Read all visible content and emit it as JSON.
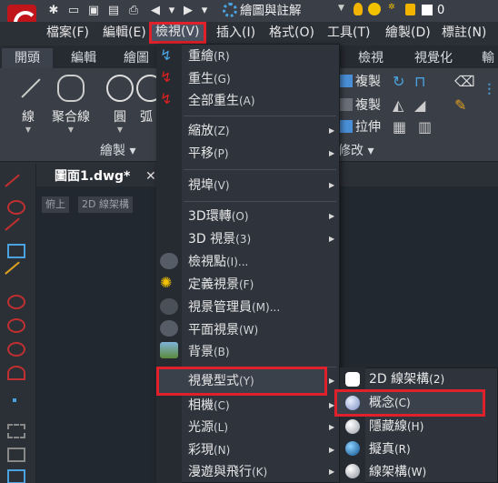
{
  "quick_access": {
    "workspace": "繪圖與註解",
    "zero_value": "0"
  },
  "menubar": {
    "items": [
      {
        "label": "檔案(F)"
      },
      {
        "label": "編輯(E)"
      },
      {
        "label": "檢視(V)"
      },
      {
        "label": "插入(I)"
      },
      {
        "label": "格式(O)"
      },
      {
        "label": "工具(T)"
      },
      {
        "label": "繪製(D)"
      },
      {
        "label": "標註(N)"
      }
    ]
  },
  "ribbon": {
    "tabs": [
      "開頭",
      "編輯",
      "繪圖",
      "檢視",
      "視覺化",
      "輸"
    ],
    "draw_buttons": [
      "線",
      "聚合線",
      "圓",
      "弧"
    ],
    "draw_panel_label": "繪製 ▾",
    "modify_rows": [
      "複製",
      "複製",
      "拉伸"
    ],
    "modify_panel_label": "修改 ▾"
  },
  "document": {
    "tab_title": "圖面1.dwg*",
    "close": "✕",
    "view_controls": [
      "俯上",
      "2D 線架構"
    ]
  },
  "view_menu": {
    "items": [
      {
        "label": "重繪",
        "key": "(R)"
      },
      {
        "label": "重生",
        "key": "(G)"
      },
      {
        "label": "全部重生",
        "key": "(A)"
      },
      {
        "label": "縮放",
        "key": "(Z)"
      },
      {
        "label": "平移",
        "key": "(P)"
      },
      {
        "label": "視埠",
        "key": "(V)"
      },
      {
        "label": "3D環轉",
        "key": "(O)"
      },
      {
        "label": "3D 視景",
        "key": "(3)"
      },
      {
        "label": "檢視點",
        "key": "(I)..."
      },
      {
        "label": "定義視景",
        "key": "(F)"
      },
      {
        "label": "視景管理員",
        "key": "(M)..."
      },
      {
        "label": "平面視景",
        "key": "(W)"
      },
      {
        "label": "背景",
        "key": "(B)"
      },
      {
        "label": "視覺型式",
        "key": "(Y)"
      },
      {
        "label": "相機",
        "key": "(C)"
      },
      {
        "label": "光源",
        "key": "(L)"
      },
      {
        "label": "彩現",
        "key": "(N)"
      },
      {
        "label": "漫遊與飛行",
        "key": "(K)"
      }
    ]
  },
  "visual_style_submenu": {
    "items": [
      {
        "label": "2D 線架構",
        "key": "(2)"
      },
      {
        "label": "概念",
        "key": "(C)"
      },
      {
        "label": "隱藏線",
        "key": "(H)"
      },
      {
        "label": "擬真",
        "key": "(R)"
      },
      {
        "label": "線架構",
        "key": "(W)"
      }
    ]
  },
  "colors": {
    "highlight_border": "#e0202a",
    "accent_red": "#c0151b"
  }
}
